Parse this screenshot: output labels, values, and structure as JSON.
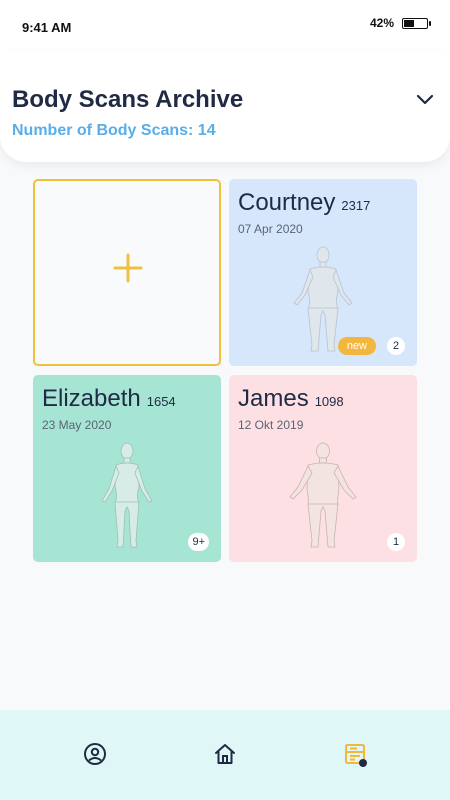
{
  "status_bar": {
    "time": "9:41 AM",
    "battery_percent": "42%",
    "battery_level": 0.42
  },
  "header": {
    "title": "Body Scans Archive",
    "count_label": "Number of Body Scans: 14",
    "toggle_icon": "chevron-down-icon"
  },
  "add_card": {
    "icon": "plus-icon"
  },
  "scans": [
    {
      "name": "Courtney",
      "id": "2317",
      "date": "07 Apr 2020",
      "badge": "new",
      "count": "2"
    },
    {
      "name": "Elizabeth",
      "id": "1654",
      "date": "23 May 2020",
      "badge": "",
      "count": "9+"
    },
    {
      "name": "James",
      "id": "1098",
      "date": "12 Okt 2019",
      "badge": "",
      "count": "1"
    }
  ],
  "bottom_nav": {
    "items": [
      "profile-icon",
      "home-icon",
      "archive-icon"
    ],
    "active": "archive-icon"
  },
  "colors": {
    "accent": "#f3b63e",
    "title": "#1f2a44",
    "count": "#5aaee8",
    "card_blue": "#d6e6fb",
    "card_green": "#a6e4d3",
    "card_pink": "#fde0e3",
    "nav_bg": "#dff8f7"
  }
}
